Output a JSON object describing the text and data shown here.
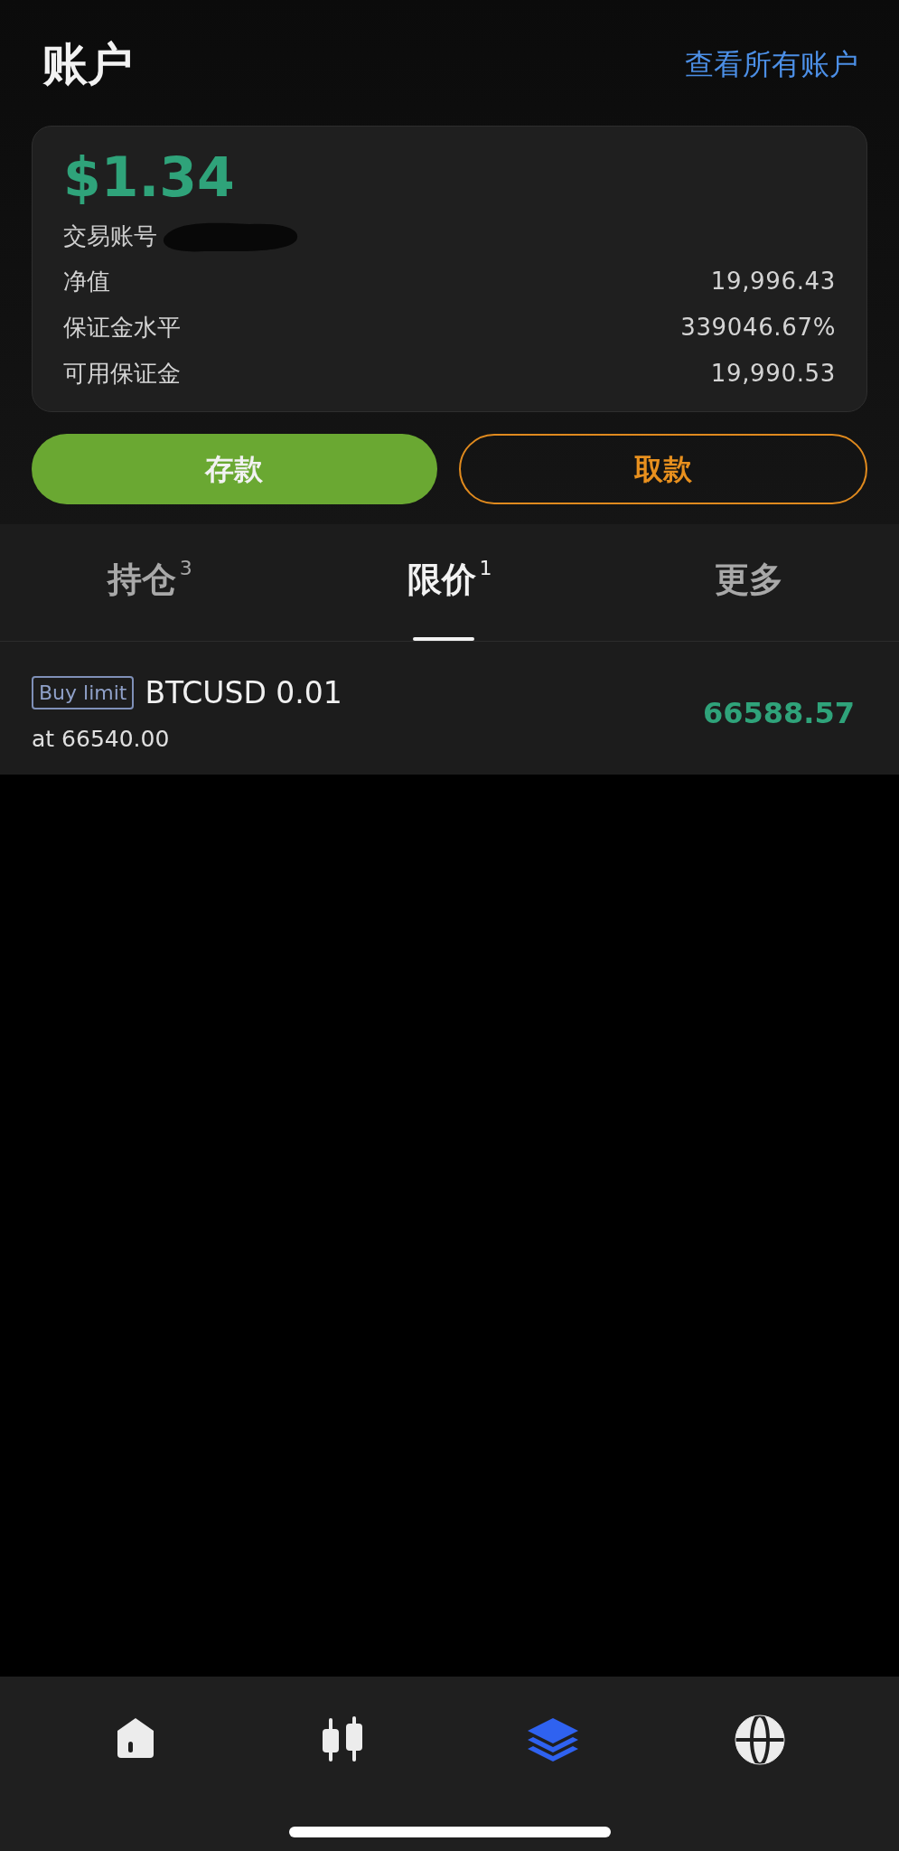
{
  "header": {
    "title": "账户",
    "link": "查看所有账户"
  },
  "account": {
    "balance": "$1.34",
    "account_label": "交易账号",
    "rows": [
      {
        "label": "净值",
        "value": "19,996.43"
      },
      {
        "label": "保证金水平",
        "value": "339046.67%"
      },
      {
        "label": "可用保证金",
        "value": "19,990.53"
      }
    ]
  },
  "buttons": [
    {
      "kind": "deposit",
      "label": "存款"
    },
    {
      "kind": "withdraw",
      "label": "取款"
    }
  ],
  "tabs": [
    {
      "label": "持仓",
      "count": "3",
      "selected": false
    },
    {
      "label": "限价",
      "count": "1",
      "selected": true
    },
    {
      "label": "更多",
      "selected": false
    }
  ],
  "orders": [
    {
      "type": "Buy limit",
      "symbol": "BTCUSD 0.01",
      "at": "at 66540.00",
      "price": "66588.57"
    }
  ],
  "nav": [
    {
      "kind": "home",
      "selected": false
    },
    {
      "kind": "chart",
      "selected": false
    },
    {
      "kind": "layers",
      "selected": true
    },
    {
      "kind": "globe",
      "selected": false
    }
  ]
}
